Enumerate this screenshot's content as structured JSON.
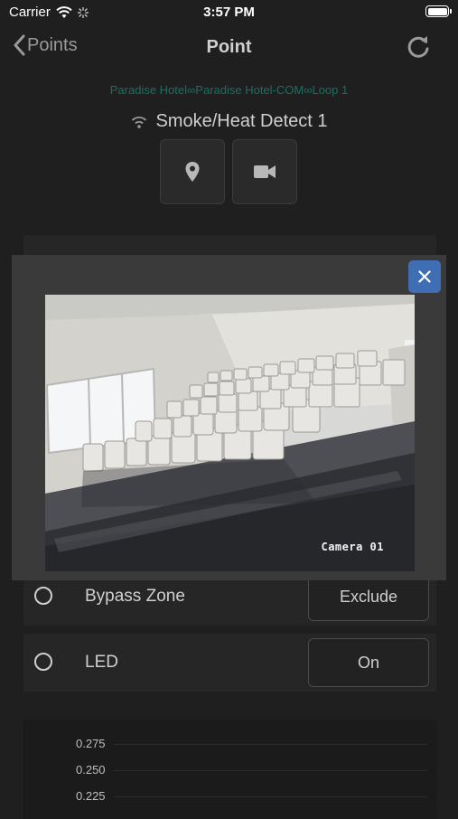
{
  "status_bar": {
    "carrier": "Carrier",
    "time": "3:57 PM"
  },
  "nav": {
    "back_label": "Points",
    "title": "Point"
  },
  "breadcrumb": "Paradise Hotel∞Paradise Hotel-COM∞Loop 1",
  "point": {
    "name": "Smoke/Heat Detect 1",
    "icon": "wireless-signal-icon"
  },
  "actions": {
    "location_icon": "location-pin-icon",
    "camera_icon": "video-camera-icon"
  },
  "modal": {
    "camera_label": "Camera 01",
    "close_icon": "close-icon"
  },
  "controls": [
    {
      "label": "Bypass Zone",
      "button": "Exclude"
    },
    {
      "label": "LED",
      "button": "On"
    }
  ],
  "chart_data": {
    "type": "line",
    "y_ticks": [
      "0.275",
      "0.250",
      "0.225"
    ],
    "grid": true
  },
  "colors": {
    "accent": "#3f6eb5",
    "breadcrumb": "#1b6f62",
    "background": "#1f1f1f"
  }
}
